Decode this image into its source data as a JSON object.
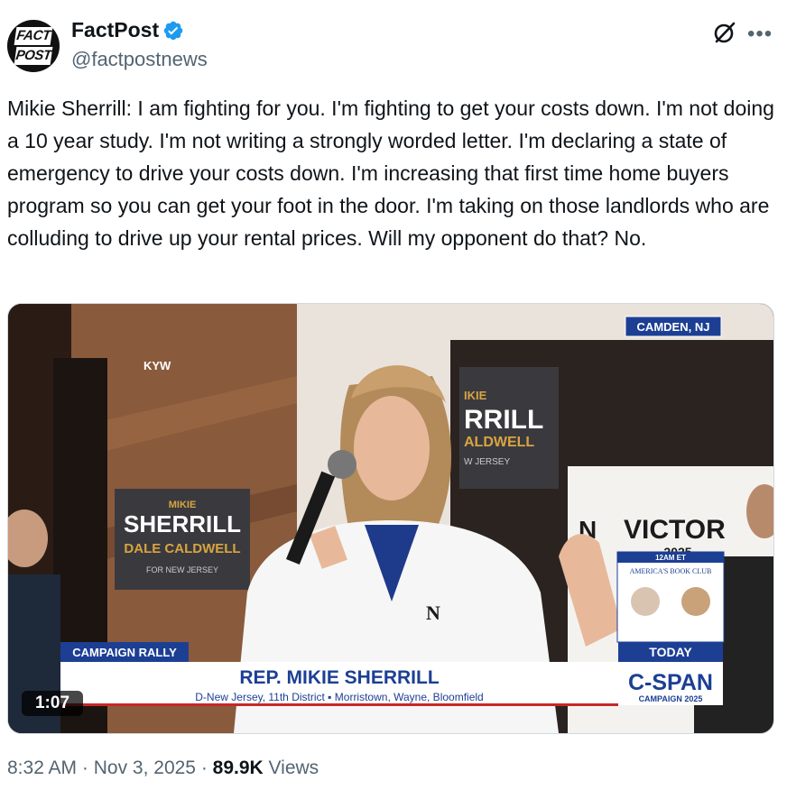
{
  "author": {
    "name": "FactPost",
    "handle": "@factpostnews",
    "avatar_text": [
      "FACT",
      "POST"
    ]
  },
  "tweet": {
    "text": "Mikie Sherrill: I am fighting for you. I'm fighting to get your costs down. I'm not doing a 10 year study. I'm not writing a strongly worded letter. I'm declaring a state of emergency to drive your costs down. I'm increasing that first time home buyers program so you can get your foot in the door. I'm taking on those landlords who are colluding to drive up your rental prices. Will my opponent do that? No."
  },
  "video": {
    "duration": "1:07",
    "location_bug": "CAMDEN, NJ",
    "station": "KYW",
    "lower_third_tag": "CAMPAIGN RALLY",
    "lower_third_name": "REP. MIKIE SHERRILL",
    "lower_third_subtitle": "D-New Jersey, 11th District  ▪  Morristown, Wayne, Bloomfield",
    "today_label": "TODAY",
    "cspan_logo": "C-SPAN",
    "cspan_sub": "CAMPAIGN 2025",
    "book_club_time": "12AM ET",
    "book_club": "AMERICA'S BOOK CLUB",
    "sign_left": [
      "MIKIE",
      "SHERRILL",
      "DALE CALDWELL",
      "FOR NEW JERSEY"
    ],
    "sign_center": [
      "IKIE",
      "RRILL",
      "ALDWELL",
      "W JERSEY"
    ],
    "sign_right": [
      "N",
      "VICTOR",
      "2025"
    ]
  },
  "meta": {
    "time": "8:32 AM",
    "date": "Nov 3, 2025",
    "views_count": "89.9K",
    "views_label": "Views"
  },
  "colors": {
    "accent": "#1d9bf0",
    "cspan_blue": "#1c3f94",
    "text_secondary": "#536471"
  }
}
